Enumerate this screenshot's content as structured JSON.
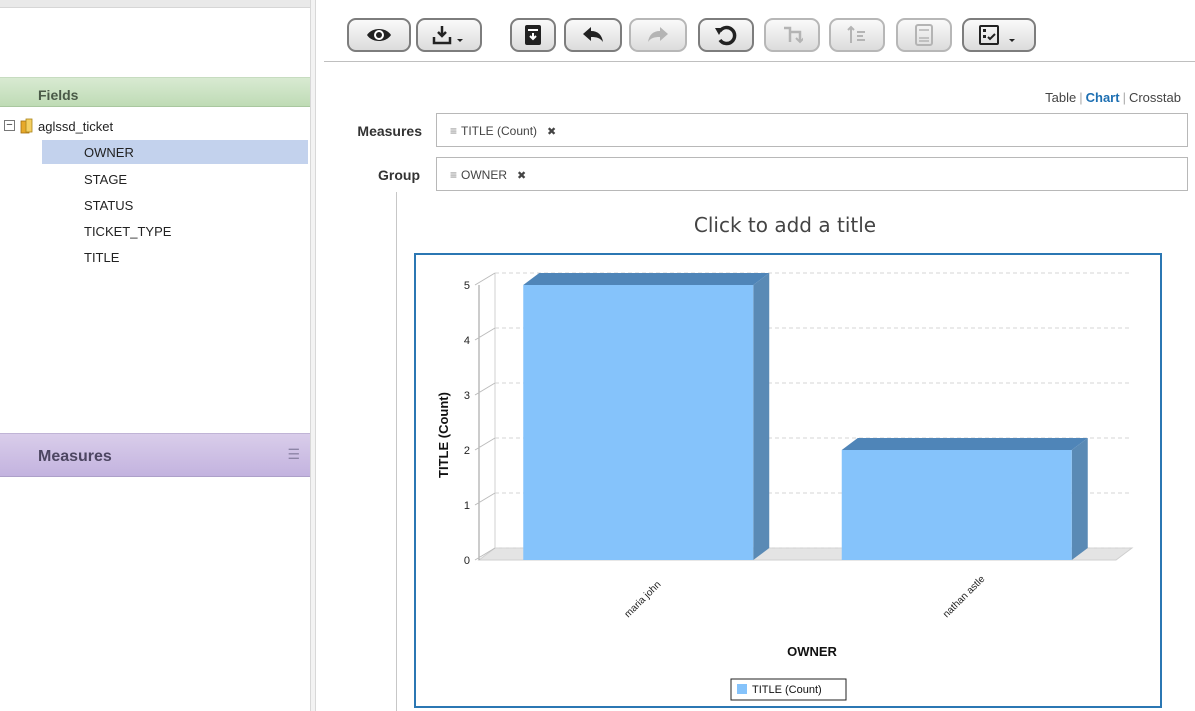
{
  "left_panel": {
    "fields_header": "Fields",
    "measures_header": "Measures",
    "tree": {
      "root_label": "aglssd_ticket",
      "items": [
        {
          "label": "OWNER",
          "selected": true
        },
        {
          "label": "STAGE",
          "selected": false
        },
        {
          "label": "STATUS",
          "selected": false
        },
        {
          "label": "TICKET_TYPE",
          "selected": false
        },
        {
          "label": "TITLE",
          "selected": false
        }
      ]
    },
    "measures_menu_icon": "menu-lines-icon"
  },
  "toolbar": {
    "buttons": [
      {
        "name": "preview-button",
        "icon": "eye-icon",
        "disabled": false,
        "dropdown": false
      },
      {
        "name": "export-button",
        "icon": "download-icon",
        "disabled": false,
        "dropdown": true
      },
      {
        "name": "save-button",
        "icon": "save-icon",
        "disabled": false,
        "dropdown": false
      },
      {
        "name": "undo-button",
        "icon": "undo-icon",
        "disabled": false,
        "dropdown": false
      },
      {
        "name": "redo-button",
        "icon": "redo-icon",
        "disabled": true,
        "dropdown": false
      },
      {
        "name": "reset-button",
        "icon": "reset-icon",
        "disabled": false,
        "dropdown": false
      },
      {
        "name": "pivot-button",
        "icon": "pivot-icon",
        "disabled": true,
        "dropdown": false
      },
      {
        "name": "sort-button",
        "icon": "sort-icon",
        "disabled": true,
        "dropdown": false
      },
      {
        "name": "page-options-button",
        "icon": "page-icon",
        "disabled": true,
        "dropdown": false
      },
      {
        "name": "options-button",
        "icon": "checklist-icon",
        "disabled": false,
        "dropdown": true
      }
    ]
  },
  "view_switch": {
    "table": "Table",
    "chart": "Chart",
    "crosstab": "Crosstab",
    "active": "chart"
  },
  "measures_row": {
    "label": "Measures",
    "pill": "TITLE (Count)"
  },
  "group_row": {
    "label": "Group",
    "pill": "OWNER"
  },
  "chart_title_placeholder": "Click to add a title",
  "colors": {
    "bar_front": "#85c3fb",
    "bar_side": "#5a8ab5",
    "bar_top": "#4f85b8",
    "frame": "#2b77b3",
    "fields_header": "#c4deb9",
    "measures_header": "#c7b8e1",
    "selected_row": "#c3d2ed"
  },
  "chart_data": {
    "type": "bar",
    "title": "",
    "categories": [
      "maria john",
      "nathan astle"
    ],
    "series": [
      {
        "name": "TITLE (Count)",
        "values": [
          5,
          2
        ]
      }
    ],
    "xlabel": "OWNER",
    "ylabel": "TITLE (Count)",
    "ylim": [
      0,
      5
    ],
    "yticks": [
      0,
      1,
      2,
      3,
      4,
      5
    ],
    "grid": true,
    "three_d": true,
    "legend": "bottom-center"
  }
}
